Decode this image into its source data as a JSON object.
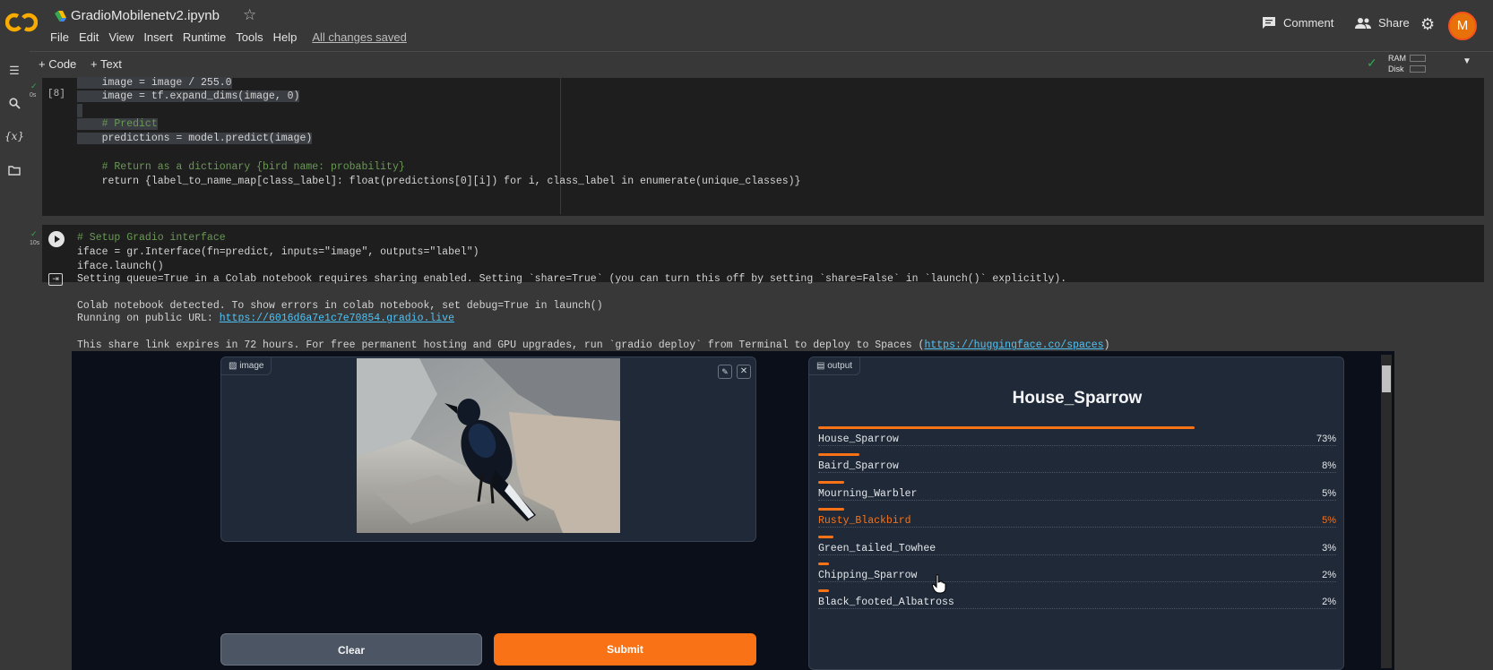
{
  "header": {
    "title": "GradioMobilenetv2.ipynb",
    "menu": [
      "File",
      "Edit",
      "View",
      "Insert",
      "Runtime",
      "Tools",
      "Help"
    ],
    "saved_status": "All changes saved",
    "comment_label": "Comment",
    "share_label": "Share",
    "avatar_letter": "M",
    "accent": "#f9ab00"
  },
  "toolbar": {
    "add_code": "+ Code",
    "add_text": "+ Text",
    "ram_label": "RAM",
    "disk_label": "Disk"
  },
  "rail": {
    "icons": [
      "toc-icon",
      "search-icon",
      "variables-icon",
      "folder-icon"
    ]
  },
  "cell1": {
    "exec_count": "[8]",
    "time": "0s",
    "lines": [
      "    image = image / 255.0",
      "    image = tf.expand_dims(image, 0)",
      "",
      "    # Predict",
      "    predictions = model.predict(image)",
      "",
      "    # Return as a dictionary {bird name: probability}",
      "    return {label_to_name_map[class_label]: float(predictions[0][i]) for i, class_label in enumerate(unique_classes)}"
    ]
  },
  "cell2": {
    "time": "10s",
    "lines": [
      "# Setup Gradio interface",
      "iface = gr.Interface(fn=predict, inputs=\"image\", outputs=\"label\")",
      "iface.launch()"
    ]
  },
  "output": {
    "line1": "Setting queue=True in a Colab notebook requires sharing enabled. Setting `share=True` (you can turn this off by setting `share=False` in `launch()` explicitly).",
    "line2": "Colab notebook detected. To show errors in colab notebook, set debug=True in launch()",
    "line3_prefix": "Running on public URL: ",
    "public_url": "https://6016d6a7e1c7e70854.gradio.live",
    "line4_prefix": "This share link expires in 72 hours. For free permanent hosting and GPU upgrades, run `gradio deploy` from Terminal to deploy to Spaces (",
    "spaces_url": "https://huggingface.co/spaces",
    "line4_suffix": ")"
  },
  "gradio": {
    "image_label": "image",
    "output_label": "output",
    "clear_label": "Clear",
    "submit_label": "Submit",
    "top_label": "House_Sparrow",
    "primary_color": "#f97316",
    "confidences": [
      {
        "label": "House_Sparrow",
        "pct": "73%",
        "value": 0.73
      },
      {
        "label": "Baird_Sparrow",
        "pct": "8%",
        "value": 0.08
      },
      {
        "label": "Mourning_Warbler",
        "pct": "5%",
        "value": 0.05
      },
      {
        "label": "Rusty_Blackbird",
        "pct": "5%",
        "value": 0.05
      },
      {
        "label": "Green_tailed_Towhee",
        "pct": "3%",
        "value": 0.03
      },
      {
        "label": "Chipping_Sparrow",
        "pct": "2%",
        "value": 0.02
      },
      {
        "label": "Black_footed_Albatross",
        "pct": "2%",
        "value": 0.02
      }
    ]
  }
}
